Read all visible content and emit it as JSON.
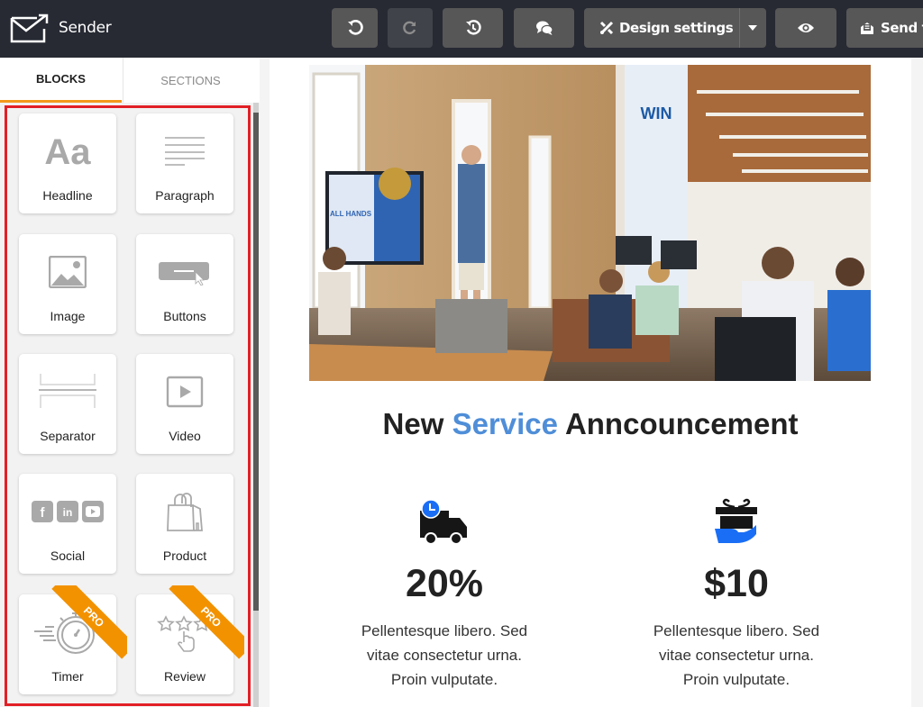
{
  "app": {
    "name": "Sender"
  },
  "toolbar": {
    "undo_icon": "undo-icon",
    "redo_icon": "redo-icon",
    "history_icon": "history-icon",
    "comments_icon": "comments-icon",
    "design_settings_label": "Design settings",
    "design_settings_icon": "design-tools-icon",
    "preview_icon": "eye-icon",
    "send_test_label": "Send t",
    "send_test_icon": "send-mail-icon"
  },
  "sidebar": {
    "tabs": [
      {
        "label": "BLOCKS",
        "active": true
      },
      {
        "label": "SECTIONS",
        "active": false
      }
    ],
    "blocks": [
      {
        "label": "Headline",
        "icon": "text-aa-icon",
        "pro": false
      },
      {
        "label": "Paragraph",
        "icon": "paragraph-lines-icon",
        "pro": false
      },
      {
        "label": "Image",
        "icon": "image-icon",
        "pro": false
      },
      {
        "label": "Buttons",
        "icon": "button-cursor-icon",
        "pro": false
      },
      {
        "label": "Separator",
        "icon": "separator-icon",
        "pro": false
      },
      {
        "label": "Video",
        "icon": "video-play-icon",
        "pro": false
      },
      {
        "label": "Social",
        "icon": "social-icons-icon",
        "pro": false
      },
      {
        "label": "Product",
        "icon": "shopping-bag-icon",
        "pro": false
      },
      {
        "label": "Timer",
        "icon": "stopwatch-icon",
        "pro": true
      },
      {
        "label": "Review",
        "icon": "star-rating-icon",
        "pro": true
      }
    ],
    "pro_badge": "PRO"
  },
  "email": {
    "hero_image_alt": "Team meeting in a brick-walled office",
    "headline": {
      "part1": "New ",
      "accent": "Service",
      "part2": " Anncouncement"
    },
    "features": [
      {
        "icon": "delivery-truck-clock-icon",
        "value": "20%",
        "lines": [
          "Pellentesque libero. Sed",
          "vitae consectetur urna.",
          "Proin vulputate."
        ]
      },
      {
        "icon": "gift-hand-icon",
        "value": "$10",
        "lines": [
          "Pellentesque libero. Sed",
          "vitae consectetur urna.",
          "Proin vulputate."
        ]
      }
    ]
  },
  "colors": {
    "topbar": "#272a33",
    "button": "#575757",
    "tab_accent": "#f39a1c",
    "highlight": "#e21f26",
    "headline_accent": "#4f8ed8",
    "pro_badge": "#f39200",
    "icon_blue": "#1a6ef5"
  }
}
